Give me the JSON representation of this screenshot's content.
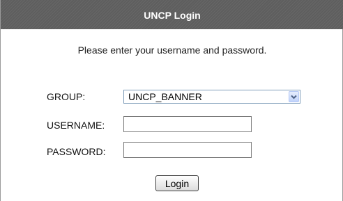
{
  "header": {
    "title": "UNCP Login"
  },
  "instructions": "Please enter your username and password.",
  "form": {
    "group_label": "GROUP:",
    "group_selected": "UNCP_BANNER",
    "username_label": "USERNAME:",
    "username_value": "",
    "password_label": "PASSWORD:",
    "password_value": "",
    "login_label": "Login"
  },
  "icons": {
    "dropdown": "chevron-down-icon"
  },
  "colors": {
    "header_bg": "#5e5e5e",
    "header_text": "#ffffff",
    "dropdown_arrow": "#4d6185"
  }
}
